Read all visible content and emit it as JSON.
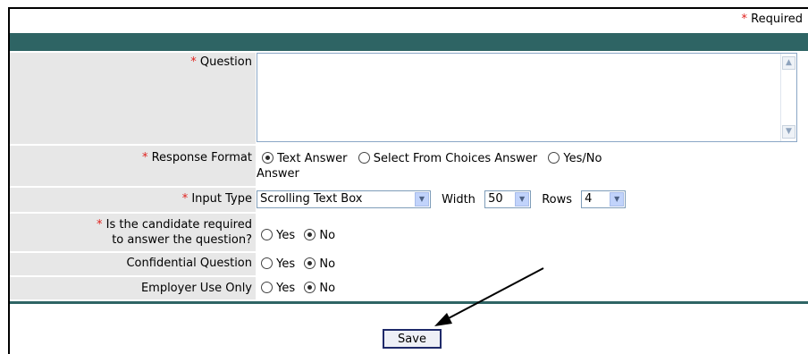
{
  "required_note": "Required",
  "required_mark": "*",
  "fields": {
    "question": {
      "label": "Question",
      "value": ""
    },
    "response_format": {
      "label": "Response Format",
      "options": [
        "Text Answer",
        "Select From Choices Answer",
        "Yes/No",
        "Answer"
      ],
      "selected": "Text Answer"
    },
    "input_type": {
      "label": "Input Type",
      "value": "Scrolling Text Box",
      "width_label": "Width",
      "width_value": "50",
      "rows_label": "Rows",
      "rows_value": "4"
    },
    "candidate_required": {
      "label_line1": "Is the candidate required",
      "label_line2": "to answer the question?",
      "yes": "Yes",
      "no": "No",
      "selected": "No"
    },
    "confidential": {
      "label": "Confidential Question",
      "yes": "Yes",
      "no": "No",
      "selected": "No"
    },
    "employer_use": {
      "label": "Employer Use Only",
      "yes": "Yes",
      "no": "No",
      "selected": "No"
    }
  },
  "save_label": "Save",
  "colors": {
    "header_bar": "#2e6464",
    "label_bg": "#e7e7e7",
    "required_star": "#e0211d"
  }
}
